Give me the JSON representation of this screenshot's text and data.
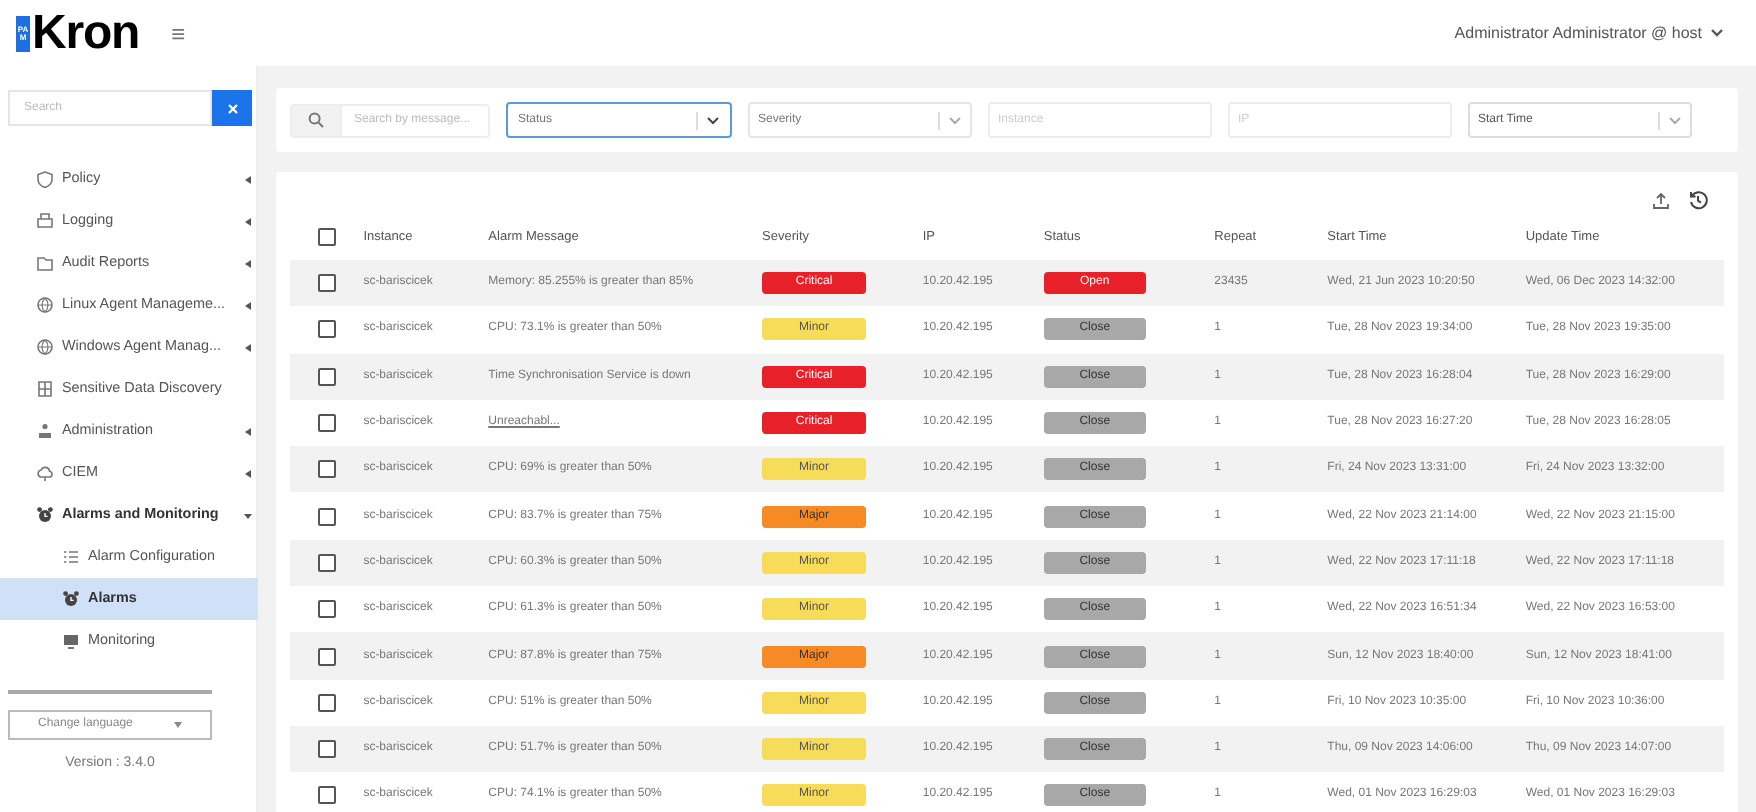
{
  "header": {
    "logo_badge": "PAM",
    "logo": "Kron",
    "menu_icon": "≡",
    "user": "Administrator Administrator @ host"
  },
  "sidebar": {
    "search": {
      "placeholder": "Search"
    },
    "items": [
      {
        "label": "Policy",
        "expanded": false,
        "selected": false
      },
      {
        "label": "Logging",
        "expanded": false,
        "selected": false
      },
      {
        "label": "Audit Reports",
        "expanded": false,
        "selected": false
      },
      {
        "label": "Linux Agent Manageme...",
        "expanded": false,
        "selected": false
      },
      {
        "label": "Windows Agent Manag...",
        "expanded": false,
        "selected": false
      },
      {
        "label": "Sensitive Data Discovery",
        "selected": false
      },
      {
        "label": "Administration",
        "expanded": false,
        "selected": false
      },
      {
        "label": "CIEM",
        "expanded": false,
        "selected": false
      },
      {
        "label": "Alarms and Monitoring",
        "expanded": true,
        "selected": false,
        "children": [
          {
            "label": "Alarm Configuration",
            "selected": false
          },
          {
            "label": "Alarms",
            "selected": true
          },
          {
            "label": "Monitoring",
            "selected": false
          }
        ]
      }
    ],
    "language": "Change language",
    "version": "Version : 3.4.0"
  },
  "filters": {
    "search": {
      "placeholder": "Search by message..."
    },
    "status": {
      "placeholder": "Status"
    },
    "severity": {
      "placeholder": "Severity"
    },
    "instance": {
      "placeholder": "Instance"
    },
    "ip": {
      "placeholder": "IP"
    },
    "start_time": {
      "value": "Start Time"
    }
  },
  "table": {
    "select_all_checked": false,
    "columns": [
      "Instance",
      "Alarm Message",
      "Severity",
      "IP",
      "Status",
      "Repeat",
      "Start Time",
      "Update Time"
    ],
    "rows": [
      {
        "checked": false,
        "instance": "sc-bariscicek",
        "message": "Memory: 85.255% is greater than 85%",
        "message_link": false,
        "severity": {
          "label": "Critical",
          "color": "#e8202a"
        },
        "ip": "10.20.42.195",
        "status": {
          "label": "Open",
          "color": "#e8202a"
        },
        "repeat": "23435",
        "start": "Wed, 21 Jun 2023 10:20:50",
        "update": "Wed, 06 Dec 2023 14:32:00"
      },
      {
        "checked": false,
        "instance": "sc-bariscicek",
        "message": "CPU: 73.1% is greater than 50%",
        "message_link": false,
        "severity": {
          "label": "Minor",
          "color": "#f7dc5a"
        },
        "ip": "10.20.42.195",
        "status": {
          "label": "Close",
          "color": "#a8a8a8"
        },
        "repeat": "1",
        "start": "Tue, 28 Nov 2023 19:34:00",
        "update": "Tue, 28 Nov 2023 19:35:00"
      },
      {
        "checked": false,
        "instance": "sc-bariscicek",
        "message": "Time Synchronisation Service is down",
        "message_link": false,
        "severity": {
          "label": "Critical",
          "color": "#e8202a"
        },
        "ip": "10.20.42.195",
        "status": {
          "label": "Close",
          "color": "#a8a8a8"
        },
        "repeat": "1",
        "start": "Tue, 28 Nov 2023 16:28:04",
        "update": "Tue, 28 Nov 2023 16:29:00"
      },
      {
        "checked": false,
        "instance": "sc-bariscicek",
        "message": "Unreachabl...",
        "message_link": true,
        "severity": {
          "label": "Critical",
          "color": "#e8202a"
        },
        "ip": "10.20.42.195",
        "status": {
          "label": "Close",
          "color": "#a8a8a8"
        },
        "repeat": "1",
        "start": "Tue, 28 Nov 2023 16:27:20",
        "update": "Tue, 28 Nov 2023 16:28:05"
      },
      {
        "checked": false,
        "instance": "sc-bariscicek",
        "message": "CPU: 69% is greater than 50%",
        "message_link": false,
        "severity": {
          "label": "Minor",
          "color": "#f7dc5a"
        },
        "ip": "10.20.42.195",
        "status": {
          "label": "Close",
          "color": "#a8a8a8"
        },
        "repeat": "1",
        "start": "Fri, 24 Nov 2023 13:31:00",
        "update": "Fri, 24 Nov 2023 13:32:00"
      },
      {
        "checked": false,
        "instance": "sc-bariscicek",
        "message": "CPU: 83.7% is greater than 75%",
        "message_link": false,
        "severity": {
          "label": "Major",
          "color": "#f68b25"
        },
        "ip": "10.20.42.195",
        "status": {
          "label": "Close",
          "color": "#a8a8a8"
        },
        "repeat": "1",
        "start": "Wed, 22 Nov 2023 21:14:00",
        "update": "Wed, 22 Nov 2023 21:15:00"
      },
      {
        "checked": false,
        "instance": "sc-bariscicek",
        "message": "CPU: 60.3% is greater than 50%",
        "message_link": false,
        "severity": {
          "label": "Minor",
          "color": "#f7dc5a"
        },
        "ip": "10.20.42.195",
        "status": {
          "label": "Close",
          "color": "#a8a8a8"
        },
        "repeat": "1",
        "start": "Wed, 22 Nov 2023 17:11:18",
        "update": "Wed, 22 Nov 2023 17:11:18"
      },
      {
        "checked": false,
        "instance": "sc-bariscicek",
        "message": "CPU: 61.3% is greater than 50%",
        "message_link": false,
        "severity": {
          "label": "Minor",
          "color": "#f7dc5a"
        },
        "ip": "10.20.42.195",
        "status": {
          "label": "Close",
          "color": "#a8a8a8"
        },
        "repeat": "1",
        "start": "Wed, 22 Nov 2023 16:51:34",
        "update": "Wed, 22 Nov 2023 16:53:00"
      },
      {
        "checked": false,
        "instance": "sc-bariscicek",
        "message": "CPU: 87.8% is greater than 75%",
        "message_link": false,
        "severity": {
          "label": "Major",
          "color": "#f68b25"
        },
        "ip": "10.20.42.195",
        "status": {
          "label": "Close",
          "color": "#a8a8a8"
        },
        "repeat": "1",
        "start": "Sun, 12 Nov 2023 18:40:00",
        "update": "Sun, 12 Nov 2023 18:41:00"
      },
      {
        "checked": false,
        "instance": "sc-bariscicek",
        "message": "CPU: 51% is greater than 50%",
        "message_link": false,
        "severity": {
          "label": "Minor",
          "color": "#f7dc5a"
        },
        "ip": "10.20.42.195",
        "status": {
          "label": "Close",
          "color": "#a8a8a8"
        },
        "repeat": "1",
        "start": "Fri, 10 Nov 2023 10:35:00",
        "update": "Fri, 10 Nov 2023 10:36:00"
      },
      {
        "checked": false,
        "instance": "sc-bariscicek",
        "message": "CPU: 51.7% is greater than 50%",
        "message_link": false,
        "severity": {
          "label": "Minor",
          "color": "#f7dc5a"
        },
        "ip": "10.20.42.195",
        "status": {
          "label": "Close",
          "color": "#a8a8a8"
        },
        "repeat": "1",
        "start": "Thu, 09 Nov 2023 14:06:00",
        "update": "Thu, 09 Nov 2023 14:07:00"
      },
      {
        "checked": false,
        "instance": "sc-bariscicek",
        "message": "CPU: 74.1% is greater than 50%",
        "message_link": false,
        "severity": {
          "label": "Minor",
          "color": "#f7dc5a"
        },
        "ip": "10.20.42.195",
        "status": {
          "label": "Close",
          "color": "#a8a8a8"
        },
        "repeat": "1",
        "start": "Wed, 01 Nov 2023 16:29:03",
        "update": "Wed, 01 Nov 2023 16:29:03"
      }
    ]
  }
}
